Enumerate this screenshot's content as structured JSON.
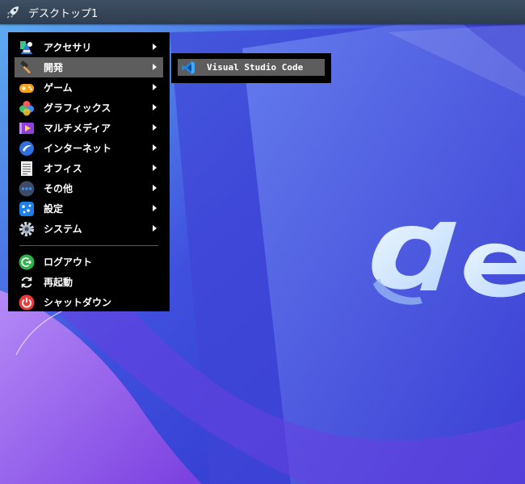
{
  "taskbar": {
    "title": "デスクトップ1",
    "launcher_icon": "rocket-icon"
  },
  "menu": {
    "items": [
      {
        "label": "アクセサリ",
        "icon": "accessories-icon",
        "submenu": true
      },
      {
        "label": "開発",
        "icon": "hammer-icon",
        "submenu": true,
        "active": true
      },
      {
        "label": "ゲーム",
        "icon": "gamepad-icon",
        "submenu": true
      },
      {
        "label": "グラフィックス",
        "icon": "graphics-icon",
        "submenu": true
      },
      {
        "label": "マルチメディア",
        "icon": "multimedia-icon",
        "submenu": true
      },
      {
        "label": "インターネット",
        "icon": "internet-icon",
        "submenu": true
      },
      {
        "label": "オフィス",
        "icon": "document-icon",
        "submenu": true
      },
      {
        "label": "その他",
        "icon": "more-icon",
        "submenu": true
      },
      {
        "label": "設定",
        "icon": "settings-icon",
        "submenu": true
      },
      {
        "label": "システム",
        "icon": "gear-icon",
        "submenu": true
      }
    ],
    "actions": [
      {
        "label": "ログアウト",
        "icon": "logout-icon"
      },
      {
        "label": "再起動",
        "icon": "restart-icon"
      },
      {
        "label": "シャットダウン",
        "icon": "power-icon"
      }
    ]
  },
  "submenu": {
    "items": [
      {
        "label": "Visual Studio Code",
        "icon": "vscode-icon"
      }
    ]
  },
  "colors": {
    "panel": "#2e3d4e",
    "menu_bg": "#000000",
    "highlight": "#5d5d5d",
    "wallpaper": "#3b46d8"
  }
}
